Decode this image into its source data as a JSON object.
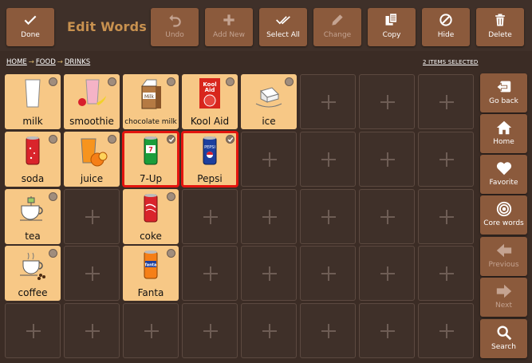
{
  "toolbar": {
    "done": "Done",
    "title": "Edit Words",
    "undo": "Undo",
    "add_new": "Add New",
    "select_all": "Select All",
    "change": "Change",
    "copy": "Copy",
    "hide": "Hide",
    "delete": "Delete"
  },
  "breadcrumb": {
    "items": [
      "HOME",
      "FOOD",
      "DRINKS"
    ],
    "separator": "→"
  },
  "selection_status": "2 ITEMS SELECTED",
  "grid": {
    "rows": [
      [
        {
          "label": "milk",
          "icon": "milk-glass-icon",
          "selected": false
        },
        {
          "label": "smoothie",
          "icon": "smoothie-icon",
          "selected": false
        },
        {
          "label": "chocolate milk",
          "icon": "chocolate-milk-carton-icon",
          "selected": false
        },
        {
          "label": "Kool Aid",
          "icon": "kool-aid-icon",
          "selected": false
        },
        {
          "label": "ice",
          "icon": "ice-cubes-icon",
          "selected": false
        },
        null,
        null,
        null
      ],
      [
        {
          "label": "soda",
          "icon": "soda-can-icon",
          "selected": false
        },
        {
          "label": "juice",
          "icon": "orange-juice-icon",
          "selected": false
        },
        {
          "label": "7-Up",
          "icon": "7up-can-icon",
          "selected": true
        },
        {
          "label": "Pepsi",
          "icon": "pepsi-can-icon",
          "selected": true
        },
        null,
        null,
        null,
        null
      ],
      [
        {
          "label": "tea",
          "icon": "tea-cup-icon",
          "selected": false
        },
        null,
        {
          "label": "coke",
          "icon": "coke-can-icon",
          "selected": false
        },
        null,
        null,
        null,
        null,
        null
      ],
      [
        {
          "label": "coffee",
          "icon": "coffee-cup-icon",
          "selected": false
        },
        null,
        {
          "label": "Fanta",
          "icon": "fanta-can-icon",
          "selected": false
        },
        null,
        null,
        null,
        null,
        null
      ],
      [
        null,
        null,
        null,
        null,
        null,
        null,
        null,
        null
      ]
    ]
  },
  "nav": {
    "go_back": "Go back",
    "home": "Home",
    "favorite": "Favorite",
    "core_words": "Core words",
    "previous": "Previous",
    "next": "Next",
    "search": "Search"
  },
  "colors": {
    "background": "#3b2c25",
    "button": "#8b5a3c",
    "word_cell": "#f7c886",
    "selection": "#e3150f",
    "title": "#c8914f"
  }
}
